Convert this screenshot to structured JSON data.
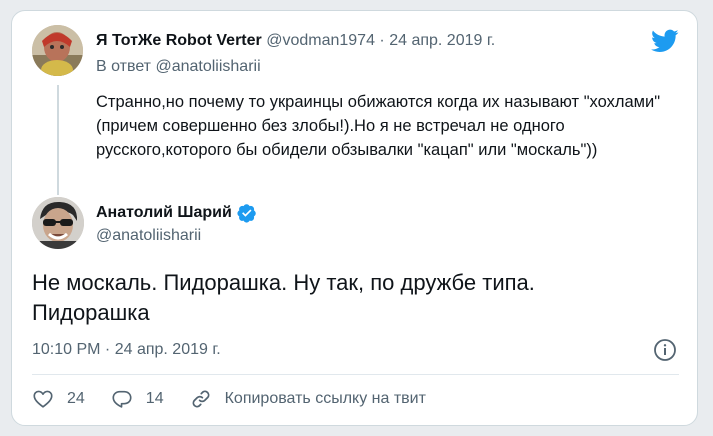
{
  "reply": {
    "author_name": "Я ТотЖе Robot Verter",
    "author_handle": "@vodman1974",
    "separator": "·",
    "date": "24 апр. 2019 г.",
    "reply_to": "В ответ @anatoliisharii",
    "text": "Странно,но почему то украинцы обижаются когда их называют \"хохлами\"(причем совершенно без злобы!).Но я не встречал не одного русского,которого бы обидели обзывалки \"кацап\" или \"москаль\"))"
  },
  "tweet": {
    "author_name": "Анатолий Шарий",
    "author_handle": "@anatoliisharii",
    "text": "Не москаль. Пидорашка. Ну так, по дружбе типа.\nПидорашка",
    "timestamp": "10:10 PM · 24 апр. 2019 г."
  },
  "actions": {
    "likes": "24",
    "replies": "14",
    "copy_link": "Копировать ссылку на твит"
  },
  "icons": {
    "brand": "twitter-bird-icon",
    "verified": "verified-badge-icon",
    "info": "info-icon",
    "like": "heart-icon",
    "reply": "reply-bubble-icon",
    "link": "link-icon"
  },
  "colors": {
    "brand_blue": "#1d9bf0",
    "text_primary": "#0f1419",
    "text_secondary": "#536471",
    "border": "#cfd9de"
  }
}
